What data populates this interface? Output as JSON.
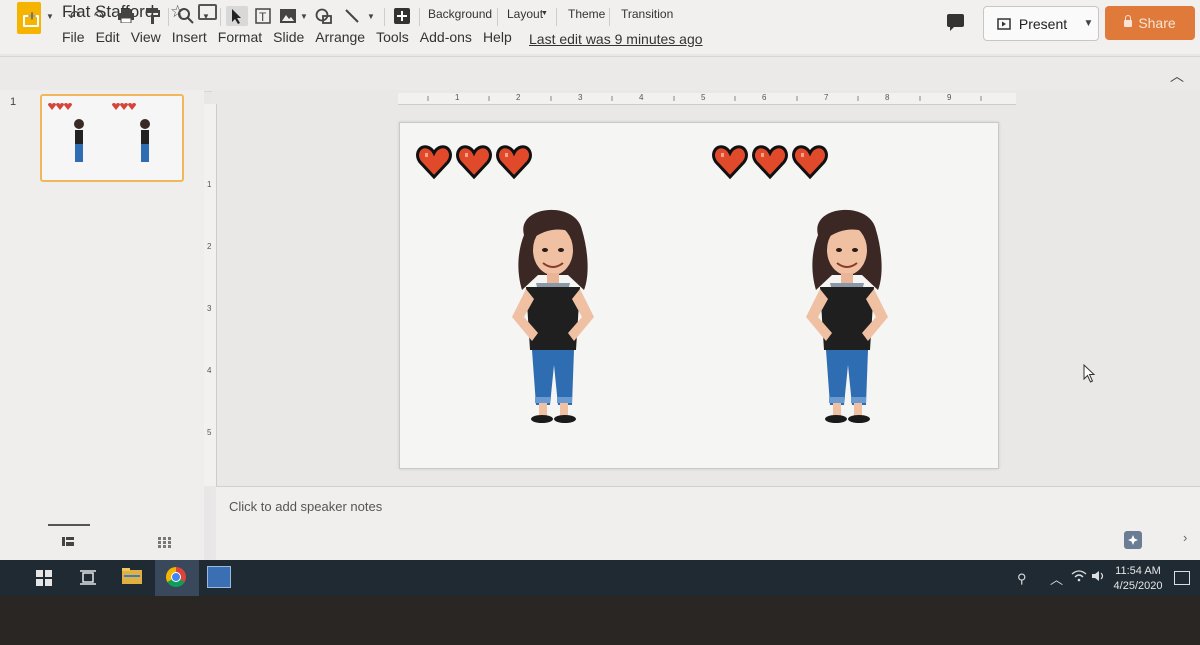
{
  "app": {
    "doc_title": "Flat Stafford",
    "menu": [
      "File",
      "Edit",
      "View",
      "Insert",
      "Format",
      "Slide",
      "Arrange",
      "Tools",
      "Add-ons",
      "Help"
    ],
    "last_edit": "Last edit was 9 minutes ago",
    "present_label": "Present",
    "share_label": "Share"
  },
  "toolbar": {
    "background_label": "Background",
    "layout_label": "Layout",
    "theme_label": "Theme",
    "transition_label": "Transition"
  },
  "ruler": {
    "top_numbers": [
      "1",
      "2",
      "3",
      "4",
      "5",
      "6",
      "7",
      "8",
      "9"
    ],
    "left_numbers": [
      "1",
      "2",
      "3",
      "4",
      "5"
    ]
  },
  "filmstrip": {
    "slide_number": "1"
  },
  "slide": {
    "hearts_per_group": 3,
    "heart_color": "#e04a2a",
    "figure_count": 2
  },
  "notes": {
    "placeholder": "Click to add speaker notes"
  },
  "taskbar": {
    "time": "11:54 AM",
    "date": "4/25/2020",
    "active_app": "chrome"
  }
}
